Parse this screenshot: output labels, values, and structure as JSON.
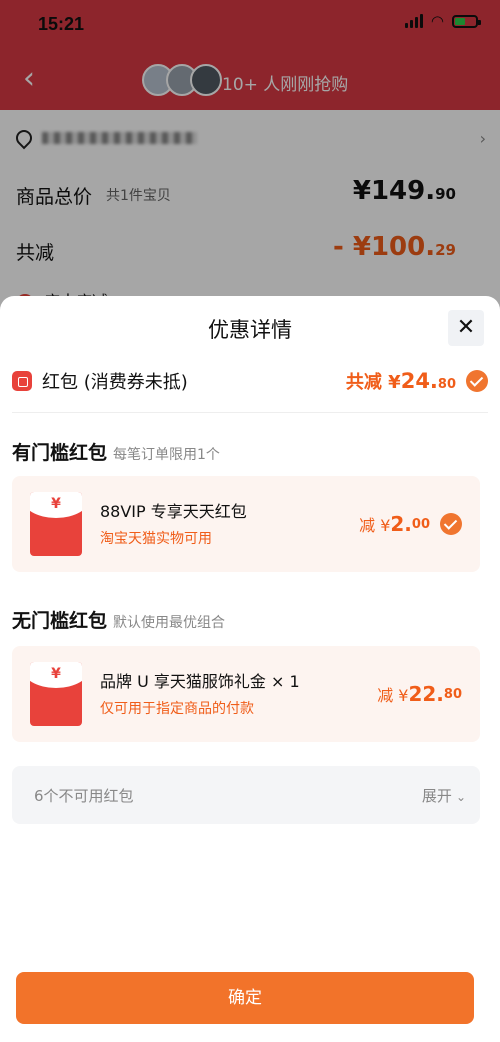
{
  "status_bar": {
    "time": "15:21"
  },
  "nav": {
    "buyers_text": "10+ 人刚刚抢购"
  },
  "background": {
    "total_label": "商品总价",
    "total_sub": "共1件宝贝",
    "total_price_int": "¥149.",
    "total_price_dec": "90",
    "reduce_label": "共减",
    "reduce_price_int": "- ¥100.",
    "reduce_price_dec": "29",
    "partial_label": "店中店减"
  },
  "sheet": {
    "title": "优惠详情",
    "hongbao_label": "红包 (消费券未抵)",
    "hongbao_total_prefix": "共减 ¥",
    "hongbao_total_int": "24.",
    "hongbao_total_dec": "80",
    "section1": {
      "title": "有门槛红包",
      "sub": "每笔订单限用1个"
    },
    "card1": {
      "yen": "¥",
      "title": "88VIP 专享天天红包",
      "sub": "淘宝天猫实物可用",
      "amt_prefix": "减 ¥",
      "amt_int": "2.",
      "amt_dec": "00",
      "selected": true
    },
    "section2": {
      "title": "无门槛红包",
      "sub": "默认使用最优组合"
    },
    "card2": {
      "yen": "¥",
      "title": "品牌 U 享天猫服饰礼金 × 1",
      "sub": "仅可用于指定商品的付款",
      "amt_prefix": "减 ¥",
      "amt_int": "22.",
      "amt_dec": "80"
    },
    "unavailable": {
      "label": "6个不可用红包",
      "expand": "展开"
    },
    "confirm": "确定"
  },
  "colors": {
    "accent": "#f2732a",
    "red": "#e8423b",
    "header": "#d93a44"
  }
}
